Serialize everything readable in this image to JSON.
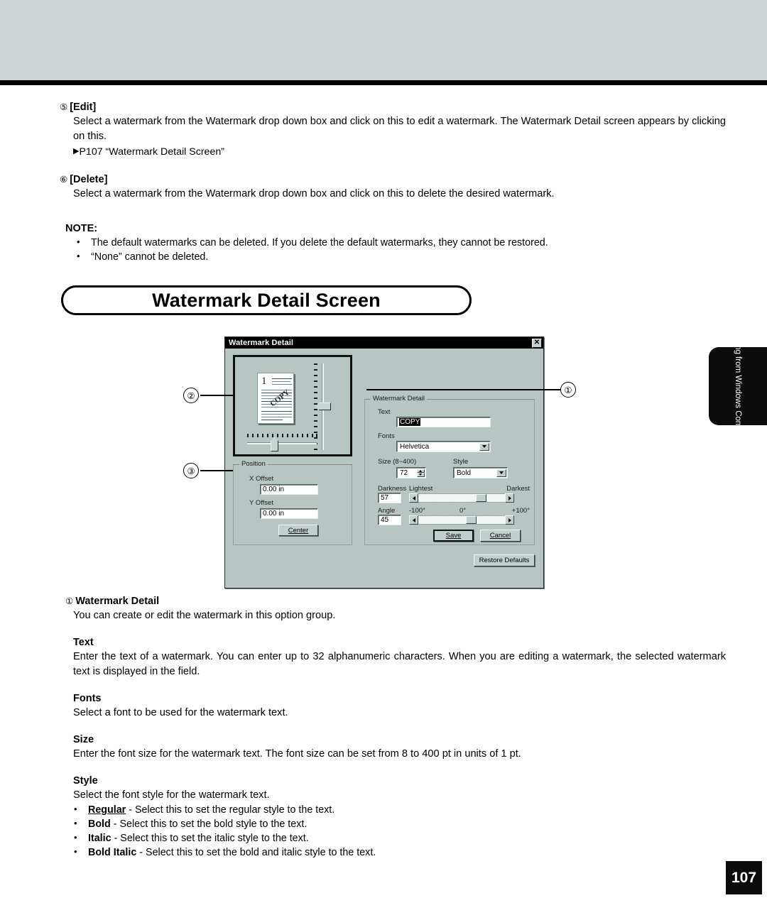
{
  "sections": [
    {
      "num": "⑤",
      "title": "[Edit]",
      "body": "Select a watermark from the Watermark drop down box and click on this to edit a watermark.  The Watermark Detail screen appears by clicking on this.",
      "ref": "P107 “Watermark Detail Screen”"
    },
    {
      "num": "⑥",
      "title": "[Delete]",
      "body": "Select a watermark from the Watermark drop down box and click on this to delete the desired watermark."
    }
  ],
  "note": {
    "heading": "NOTE:",
    "bullets": [
      "The default watermarks can be deleted.  If you delete the default watermarks, they cannot be restored.",
      "“None” cannot be deleted."
    ]
  },
  "banner": {
    "title": "Watermark Detail Screen"
  },
  "side_tab": {
    "label": "Printing from\nWindows Computer"
  },
  "page_number": "107",
  "callouts": [
    {
      "id": "1",
      "label": "①"
    },
    {
      "id": "2",
      "label": "②"
    },
    {
      "id": "3",
      "label": "③"
    }
  ],
  "dialog": {
    "title": "Watermark Detail",
    "close_label": "✕",
    "preview": {
      "thumbnail_number": "1",
      "watermark_mark": "COPY"
    },
    "position_group": {
      "legend": "Position",
      "x_offset_label": "X Offset",
      "x_offset_value": "0.00 in",
      "y_offset_label": "Y Offset",
      "y_offset_value": "0.00 in",
      "center_button": "Center"
    },
    "detail_group": {
      "legend": "Watermark Detail",
      "text_label": "Text",
      "text_value": "COPY",
      "fonts_label": "Fonts",
      "fonts_value": "Helvetica",
      "size_label": "Size (8~400)",
      "size_value": "72",
      "style_label": "Style",
      "style_value": "Bold",
      "darkness_label": "Darkness",
      "darkness_value": "57",
      "darkness_min_label": "Lightest",
      "darkness_max_label": "Darkest",
      "angle_label": "Angle",
      "angle_value": "45",
      "angle_min_label": "-100°",
      "angle_mid_label": "0°",
      "angle_max_label": "+100°",
      "save_button": "Save",
      "cancel_button": "Cancel"
    },
    "restore_button": "Restore Defaults"
  },
  "descriptions": [
    {
      "num": "①",
      "title": "Watermark Detail",
      "body": "You can create or edit the watermark in this option group."
    },
    {
      "title": "Text",
      "body": "Enter the text of a watermark.  You can enter up to 32 alphanumeric characters.  When you are editing a watermark, the selected watermark text is displayed in the field."
    },
    {
      "title": "Fonts",
      "body": "Select a font to be used for the watermark text."
    },
    {
      "title": "Size",
      "body": "Enter the font size for the watermark text.  The font size can be set from 8 to 400 pt in units of 1 pt."
    },
    {
      "title": "Style",
      "body": "Select the font style for the watermark text."
    }
  ],
  "style_bullets": [
    {
      "name": "Regular",
      "rest": " - Select this to set the regular style to the text."
    },
    {
      "name": "Bold",
      "rest": " -  Select this to set the bold style to the text."
    },
    {
      "name": "Italic",
      "rest": " - Select this to set the italic style to the text."
    },
    {
      "name": "Bold Italic",
      "rest": " - Select this to set the bold and italic style to the text."
    }
  ]
}
